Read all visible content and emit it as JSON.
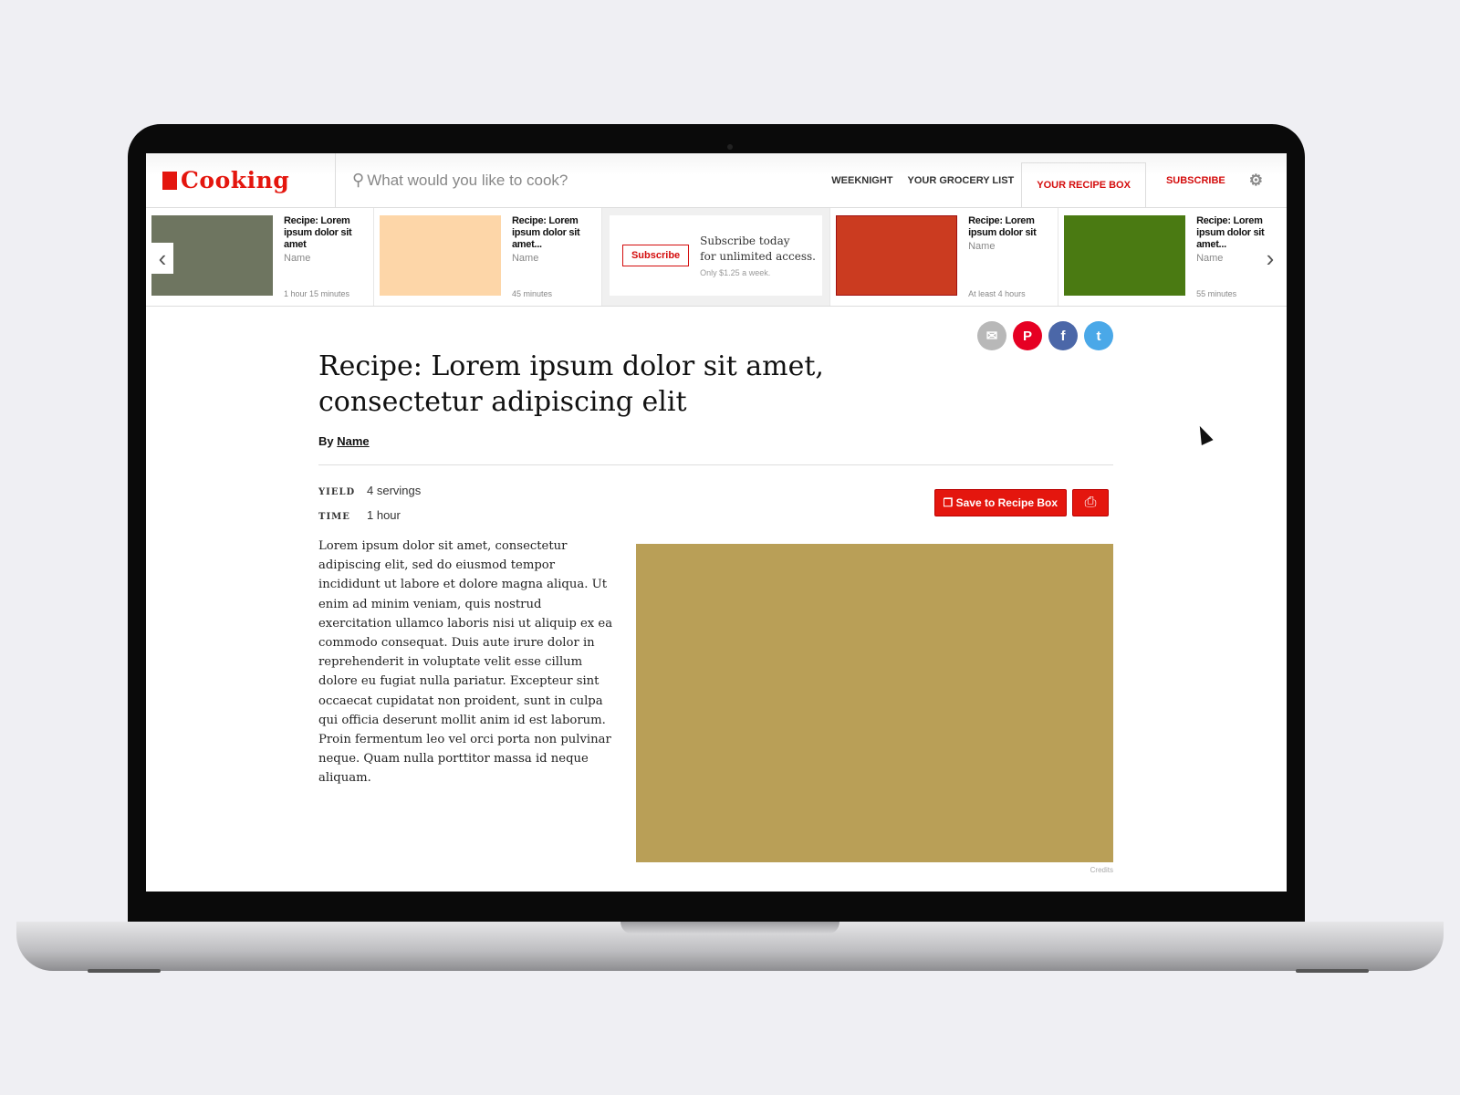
{
  "header": {
    "logo": "Cooking",
    "search_placeholder": "What would you like to cook?",
    "nav": [
      "WEEKNIGHT",
      "YOUR GROCERY LIST",
      "YOUR RECIPE BOX",
      "SUBSCRIBE"
    ]
  },
  "carousel": {
    "cards": [
      {
        "title": "Recipe: Lorem ipsum dolor sit amet",
        "author": "Name",
        "duration": "1 hour 15 minutes",
        "color": "#6e7560"
      },
      {
        "title": "Recipe: Lorem ipsum dolor sit amet...",
        "author": "Name",
        "duration": "45 minutes",
        "color": "#fdd6a8"
      },
      {
        "title": "Recipe: Lorem ipsum dolor sit",
        "author": "Name",
        "duration": "At least 4 hours",
        "color": "#cb3b20"
      },
      {
        "title": "Recipe: Lorem ipsum dolor sit amet...",
        "author": "Name",
        "duration": "55 minutes",
        "color": "#4a7a12"
      }
    ],
    "promo": {
      "button": "Subscribe",
      "line1": "Subscribe today",
      "line2": "for unlimited access.",
      "price": "Only $1.25 a week."
    }
  },
  "recipe": {
    "title": "Recipe: Lorem ipsum dolor sit amet, consectetur adipiscing elit",
    "by": "By",
    "author": "Name",
    "yield_label": "YIELD",
    "yield": "4 servings",
    "time_label": "TIME",
    "time": "1 hour",
    "save_label": "Save to Recipe Box",
    "description": "Lorem ipsum dolor sit amet, consectetur adipiscing elit, sed do eiusmod tempor incididunt ut labore et dolore magna aliqua. Ut enim ad minim veniam, quis nostrud exercitation ullamco laboris nisi ut aliquip ex ea commodo consequat. Duis aute irure dolor in reprehenderit in voluptate velit esse cillum dolore eu fugiat nulla pariatur. Excepteur sint occaecat cupidatat non proident, sunt in culpa qui officia deserunt mollit anim id est laborum. Proin fermentum leo vel orci porta non pulvinar neque. Quam nulla porttitor massa id neque aliquam.",
    "photo_color": "#b99f57",
    "credits": "Credits"
  },
  "colors": {
    "accent": "#e4160e",
    "email": "#b8b8b8",
    "pinterest": "#e60023",
    "facebook": "#4b67a8",
    "twitter": "#4aa8e8"
  }
}
